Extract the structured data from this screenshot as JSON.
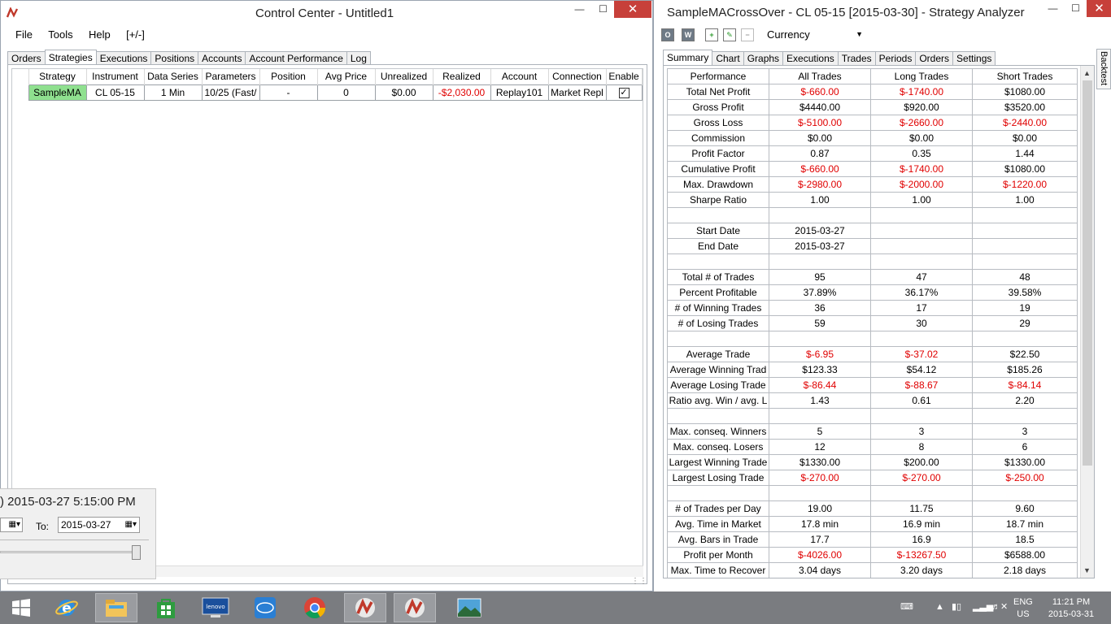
{
  "control_center": {
    "title": "Control Center - Untitled1",
    "menu": [
      "File",
      "Tools",
      "Help",
      "[+/-]"
    ],
    "tabs": [
      "Orders",
      "Strategies",
      "Executions",
      "Positions",
      "Accounts",
      "Account Performance",
      "Log"
    ],
    "active_tab": "Strategies",
    "columns": [
      "Strategy",
      "Instrument",
      "Data Series",
      "Parameters",
      "Position",
      "Avg Price",
      "Unrealized",
      "Realized",
      "Account",
      "Connection",
      "Enable"
    ],
    "rows": [
      {
        "strategy": "SampleMA",
        "instrument": "CL 05-15",
        "data_series": "1 Min",
        "parameters": "10/25 (Fast/",
        "position": "-",
        "avg_price": "0",
        "unrealized": "$0.00",
        "realized": "-$2,030.00",
        "account": "Replay101",
        "connection": "Market Repl",
        "enable": true
      }
    ]
  },
  "playback": {
    "time": "2015-03-27 5:15:00 PM",
    "to_label": "To:",
    "to_date": "2015-03-27"
  },
  "analyzer": {
    "title": "SampleMACrossOver - CL 05-15 [2015-03-30] - Strategy Analyzer",
    "currency": "Currency",
    "tabs": [
      "Summary",
      "Chart",
      "Graphs",
      "Executions",
      "Trades",
      "Periods",
      "Orders",
      "Settings"
    ],
    "active_tab": "Summary",
    "side_tab": "Backtest",
    "columns": [
      "Performance",
      "All Trades",
      "Long Trades",
      "Short Trades"
    ],
    "rows": [
      {
        "label": "Total Net Profit",
        "all": "$-660.00",
        "long": "$-1740.00",
        "short": "$1080.00",
        "neg": [
          true,
          true,
          false
        ]
      },
      {
        "label": "Gross Profit",
        "all": "$4440.00",
        "long": "$920.00",
        "short": "$3520.00",
        "neg": [
          false,
          false,
          false
        ]
      },
      {
        "label": "Gross Loss",
        "all": "$-5100.00",
        "long": "$-2660.00",
        "short": "$-2440.00",
        "neg": [
          true,
          true,
          true
        ]
      },
      {
        "label": "Commission",
        "all": "$0.00",
        "long": "$0.00",
        "short": "$0.00",
        "neg": [
          false,
          false,
          false
        ]
      },
      {
        "label": "Profit Factor",
        "all": "0.87",
        "long": "0.35",
        "short": "1.44",
        "neg": [
          false,
          false,
          false
        ]
      },
      {
        "label": "Cumulative Profit",
        "all": "$-660.00",
        "long": "$-1740.00",
        "short": "$1080.00",
        "neg": [
          true,
          true,
          false
        ]
      },
      {
        "label": "Max. Drawdown",
        "all": "$-2980.00",
        "long": "$-2000.00",
        "short": "$-1220.00",
        "neg": [
          true,
          true,
          true
        ]
      },
      {
        "label": "Sharpe Ratio",
        "all": "1.00",
        "long": "1.00",
        "short": "1.00",
        "neg": [
          false,
          false,
          false
        ]
      },
      {
        "label": "",
        "all": "",
        "long": "",
        "short": "",
        "neg": [
          false,
          false,
          false
        ]
      },
      {
        "label": "Start Date",
        "all": "2015-03-27",
        "long": "",
        "short": "",
        "neg": [
          false,
          false,
          false
        ]
      },
      {
        "label": "End Date",
        "all": "2015-03-27",
        "long": "",
        "short": "",
        "neg": [
          false,
          false,
          false
        ]
      },
      {
        "label": "",
        "all": "",
        "long": "",
        "short": "",
        "neg": [
          false,
          false,
          false
        ]
      },
      {
        "label": "Total # of Trades",
        "all": "95",
        "long": "47",
        "short": "48",
        "neg": [
          false,
          false,
          false
        ]
      },
      {
        "label": "Percent Profitable",
        "all": "37.89%",
        "long": "36.17%",
        "short": "39.58%",
        "neg": [
          false,
          false,
          false
        ]
      },
      {
        "label": "# of Winning Trades",
        "all": "36",
        "long": "17",
        "short": "19",
        "neg": [
          false,
          false,
          false
        ]
      },
      {
        "label": "# of Losing Trades",
        "all": "59",
        "long": "30",
        "short": "29",
        "neg": [
          false,
          false,
          false
        ]
      },
      {
        "label": "",
        "all": "",
        "long": "",
        "short": "",
        "neg": [
          false,
          false,
          false
        ]
      },
      {
        "label": "Average Trade",
        "all": "$-6.95",
        "long": "$-37.02",
        "short": "$22.50",
        "neg": [
          true,
          true,
          false
        ]
      },
      {
        "label": "Average Winning Trad",
        "all": "$123.33",
        "long": "$54.12",
        "short": "$185.26",
        "neg": [
          false,
          false,
          false
        ]
      },
      {
        "label": "Average Losing Trade",
        "all": "$-86.44",
        "long": "$-88.67",
        "short": "$-84.14",
        "neg": [
          true,
          true,
          true
        ]
      },
      {
        "label": "Ratio avg. Win / avg. L",
        "all": "1.43",
        "long": "0.61",
        "short": "2.20",
        "neg": [
          false,
          false,
          false
        ]
      },
      {
        "label": "",
        "all": "",
        "long": "",
        "short": "",
        "neg": [
          false,
          false,
          false
        ]
      },
      {
        "label": "Max. conseq. Winners",
        "all": "5",
        "long": "3",
        "short": "3",
        "neg": [
          false,
          false,
          false
        ]
      },
      {
        "label": "Max. conseq. Losers",
        "all": "12",
        "long": "8",
        "short": "6",
        "neg": [
          false,
          false,
          false
        ]
      },
      {
        "label": "Largest Winning Trade",
        "all": "$1330.00",
        "long": "$200.00",
        "short": "$1330.00",
        "neg": [
          false,
          false,
          false
        ]
      },
      {
        "label": "Largest Losing Trade",
        "all": "$-270.00",
        "long": "$-270.00",
        "short": "$-250.00",
        "neg": [
          true,
          true,
          true
        ]
      },
      {
        "label": "",
        "all": "",
        "long": "",
        "short": "",
        "neg": [
          false,
          false,
          false
        ]
      },
      {
        "label": "# of Trades per Day",
        "all": "19.00",
        "long": "11.75",
        "short": "9.60",
        "neg": [
          false,
          false,
          false
        ]
      },
      {
        "label": "Avg. Time in Market",
        "all": "17.8 min",
        "long": "16.9 min",
        "short": "18.7 min",
        "neg": [
          false,
          false,
          false
        ]
      },
      {
        "label": "Avg. Bars in Trade",
        "all": "17.7",
        "long": "16.9",
        "short": "18.5",
        "neg": [
          false,
          false,
          false
        ]
      },
      {
        "label": "Profit per Month",
        "all": "$-4026.00",
        "long": "$-13267.50",
        "short": "$6588.00",
        "neg": [
          true,
          true,
          false
        ]
      },
      {
        "label": "Max. Time to Recover",
        "all": "3.04 days",
        "long": "3.20 days",
        "short": "2.18 days",
        "neg": [
          false,
          false,
          false
        ]
      }
    ]
  },
  "taskbar": {
    "apps": [
      "start-icon",
      "internet-explorer-icon",
      "file-explorer-icon",
      "store-icon",
      "lenovo-icon",
      "intel-icon",
      "chrome-icon",
      "ninjatrader-icon",
      "ninjatrader-icon",
      "photos-icon"
    ],
    "lenovo_label": "lenovo",
    "language": "ENG",
    "region": "US",
    "time": "11:21 PM",
    "date": "2015-03-31"
  },
  "colors": {
    "negative": "#e00000",
    "strategy_cell": "#8fe08f",
    "close_button": "#c7403a",
    "taskbar": "#7a7c80"
  }
}
